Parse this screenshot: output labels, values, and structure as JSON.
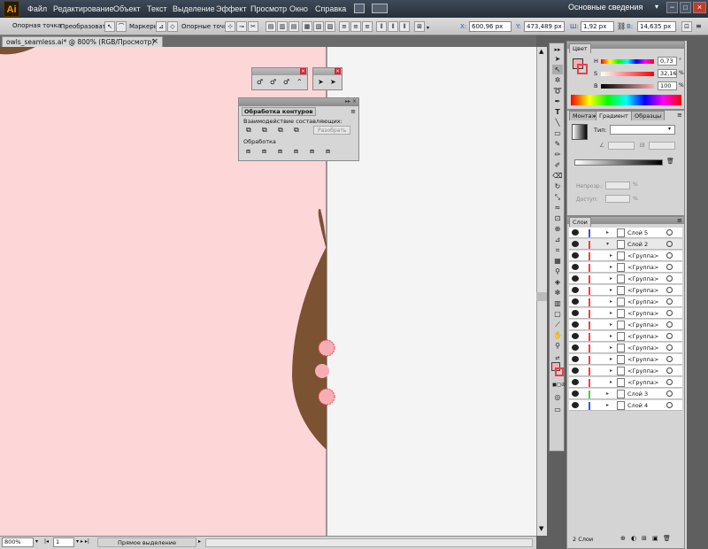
{
  "menubar": {
    "app_logo": "Ai",
    "items": [
      "Файл",
      "Редактирование",
      "Объект",
      "Текст",
      "Выделение",
      "Эффект",
      "Просмотр",
      "Окно",
      "Справка"
    ],
    "workspace": "Основные сведения",
    "window_controls": [
      "−",
      "□",
      "×"
    ]
  },
  "control_bar": {
    "anchor_label": "Опорная точка",
    "convert_label": "Преобразовать:",
    "handles_label": "Маркеры:",
    "anchors_label": "Опорные точки:",
    "x_label": "X:",
    "x_value": "600,96 px",
    "y_label": "Y:",
    "y_value": "473,489 px",
    "w_label": "Ш:",
    "w_value": "1,92 px",
    "h_label": "В:",
    "h_value": "14,635 px"
  },
  "document": {
    "tab_title": "owls_seamless.ai* @ 800% (RGB/Просмотр)",
    "close_glyph": "×"
  },
  "colors": {
    "canvas_pink": "#fdd6d8",
    "canvas_gray": "#f4f4f4",
    "owl_brown": "#7b5232",
    "selected_pink": "#f6aeb4",
    "selection_red": "#e8414a"
  },
  "pathfinder": {
    "title": "Обработка контуров",
    "shape_modes_label": "Взаимодействие составляющих:",
    "expand_button": "Разобрать",
    "pathfinders_label": "Обработка"
  },
  "color_panel": {
    "tab": "Цвет",
    "h_label": "H",
    "h_value": "0,73",
    "s_label": "S",
    "s_value": "32,16",
    "b_label": "B",
    "b_value": "100",
    "degree": "°",
    "percent": "%"
  },
  "gradient_panel": {
    "tabs": [
      "Монтаж",
      "Градиент",
      "Образцы"
    ],
    "type_label": "Тип:",
    "opacity_label": "Непрозр.:",
    "location_label": "Доступ:",
    "percent": "%"
  },
  "layers_panel": {
    "tab": "Слои",
    "footer": "2 Слои",
    "rows": [
      {
        "name": "Слой 5",
        "color": "#3b4cff",
        "indent": false
      },
      {
        "name": "Слой 2",
        "color": "#ff3b3b",
        "indent": false
      },
      {
        "name": "<Группа>",
        "color": "#ff3b3b",
        "indent": true
      },
      {
        "name": "<Группа>",
        "color": "#ff3b3b",
        "indent": true
      },
      {
        "name": "<Группа>",
        "color": "#ff3b3b",
        "indent": true
      },
      {
        "name": "<Группа>",
        "color": "#ff3b3b",
        "indent": true
      },
      {
        "name": "<Группа>",
        "color": "#ff3b3b",
        "indent": true
      },
      {
        "name": "<Группа>",
        "color": "#ff3b3b",
        "indent": true
      },
      {
        "name": "<Группа>",
        "color": "#ff3b3b",
        "indent": true
      },
      {
        "name": "<Группа>",
        "color": "#ff3b3b",
        "indent": true
      },
      {
        "name": "<Группа>",
        "color": "#ff3b3b",
        "indent": true
      },
      {
        "name": "<Группа>",
        "color": "#ff3b3b",
        "indent": true
      },
      {
        "name": "<Группа>",
        "color": "#ff3b3b",
        "indent": true
      },
      {
        "name": "<Группа>",
        "color": "#ff3b3b",
        "indent": true
      },
      {
        "name": "Слой 3",
        "color": "#3bd13b",
        "indent": false
      },
      {
        "name": "Слой 4",
        "color": "#3b4cff",
        "indent": false
      }
    ]
  },
  "status_bar": {
    "zoom": "800%",
    "artboard": "1",
    "tool": "Прямое выделение"
  }
}
